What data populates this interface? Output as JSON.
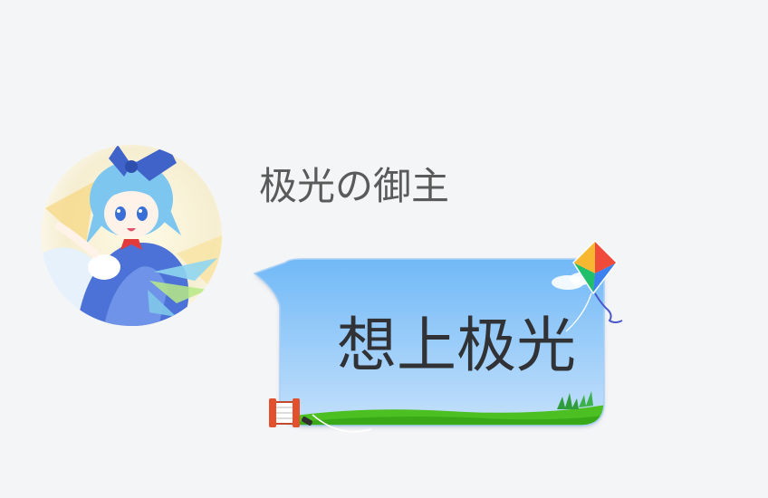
{
  "message": {
    "sender_name": "极光の御主",
    "text": "想上极光",
    "avatar_icon": "anime-character-avatar",
    "bubble_theme": {
      "sky_top": "#71b9f7",
      "sky_bottom": "#c4e0fb",
      "grass": "#4cbf22",
      "text_color": "#303235",
      "name_color": "#5a5a5a"
    },
    "decorations": [
      "kite-icon",
      "string-spool-icon",
      "grass-icon",
      "cloud-icon"
    ]
  }
}
